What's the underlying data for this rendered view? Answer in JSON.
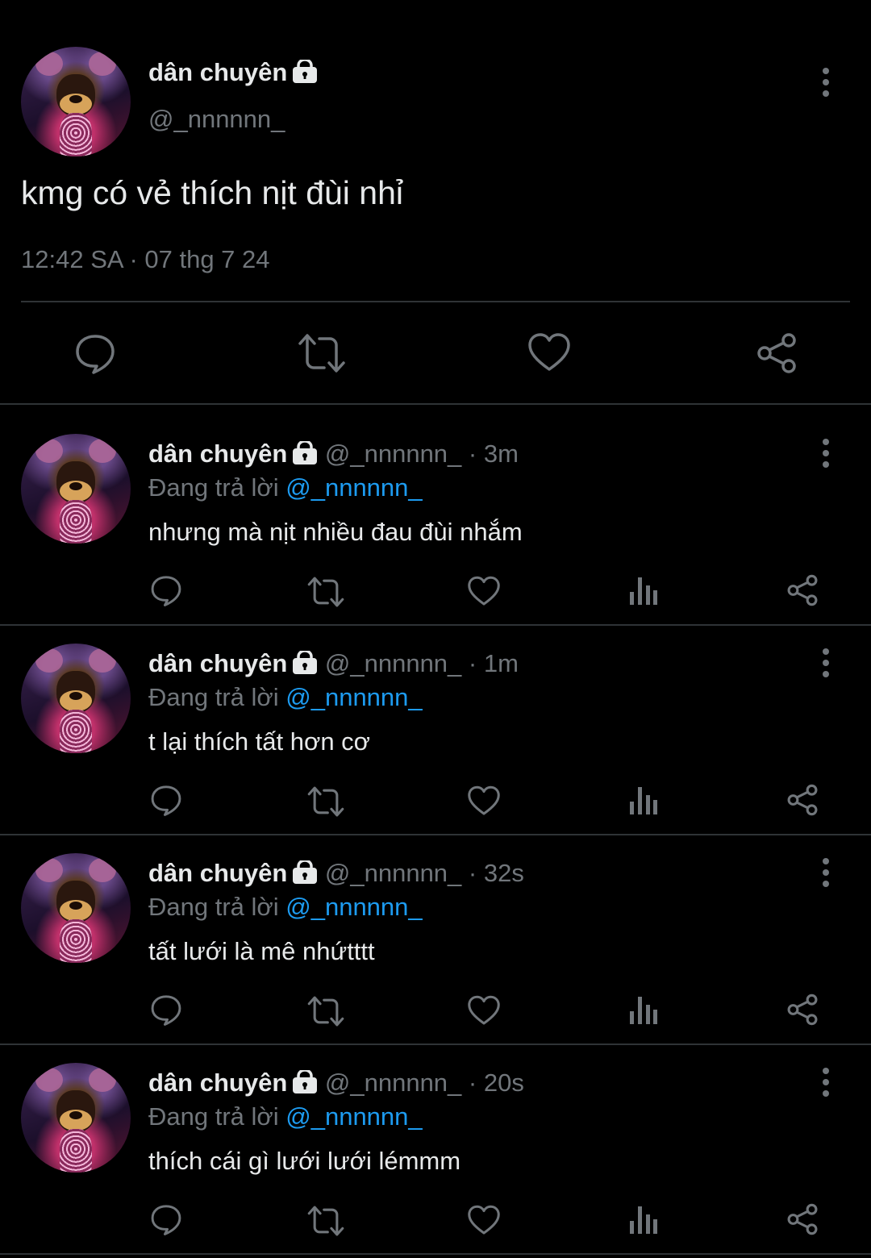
{
  "main_tweet": {
    "author_name": "dân chuyên",
    "handle": "@_nnnnnn_",
    "text": "kmg có vẻ thích nịt đùi nhỉ",
    "timestamp": "12:42 SA · 07 thg 7 24"
  },
  "replying_label": "Đang trả lời",
  "replies": [
    {
      "name": "dân chuyên",
      "handle": "@_nnnnnn_",
      "age": " · 3m",
      "reply_to": "@_nnnnnn_",
      "text": "nhưng mà nịt nhiều đau đùi nhắm"
    },
    {
      "name": "dân chuyên",
      "handle": "@_nnnnnn_",
      "age": " · 1m",
      "reply_to": "@_nnnnnn_",
      "text": "t lại thích tất hơn cơ"
    },
    {
      "name": "dân chuyên",
      "handle": "@_nnnnnn_",
      "age": " · 32s",
      "reply_to": "@_nnnnnn_",
      "text": "tất lưới là mê nhứtttt"
    },
    {
      "name": "dân chuyên",
      "handle": "@_nnnnnn_",
      "age": " · 20s",
      "reply_to": "@_nnnnnn_",
      "text": "thích cái gì lưới lưới lémmm"
    }
  ],
  "icons": {
    "reply": "speech-bubble-icon",
    "retweet": "retweet-arrows-icon",
    "like": "heart-icon",
    "views": "bar-chart-icon",
    "share": "share-nodes-icon",
    "more": "vertical-dots-icon",
    "protected": "lock-icon"
  },
  "colors": {
    "background": "#000000",
    "text": "#e7e9ea",
    "secondary": "#71767b",
    "link": "#1d9bf0",
    "divider": "#2f3336"
  }
}
